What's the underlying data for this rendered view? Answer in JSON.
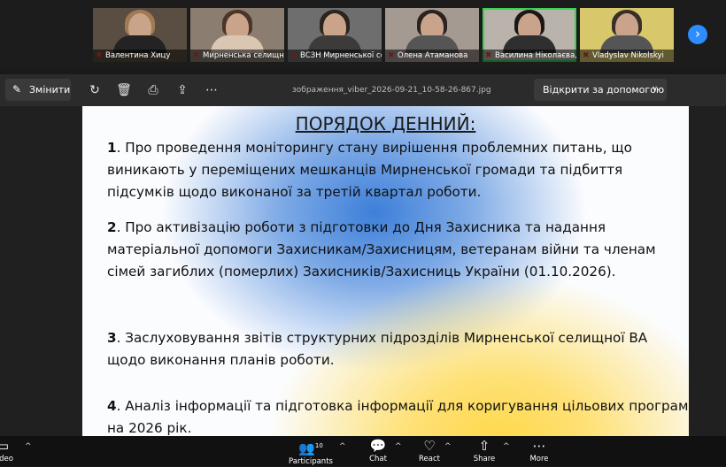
{
  "participants": [
    {
      "name": "Валентина Хицу",
      "hair": "#a07a54",
      "body": "#232323",
      "bg": "#5a4d42"
    },
    {
      "name": "Мирненська селищна ...",
      "hair": "#4a3628",
      "body": "#d9c7b3",
      "bg": "#8b7d70"
    },
    {
      "name": "ВСЗН Мирненської се...",
      "hair": "#2c241e",
      "body": "#3d3a3a",
      "bg": "#6e6e6e"
    },
    {
      "name": "Олена Атаманова",
      "hair": "#2b2320",
      "body": "#555555",
      "bg": "#a49a92"
    },
    {
      "name": "Василина Ніколаєва, Мир...",
      "hair": "#1c1715",
      "body": "#2f2f2f",
      "bg": "#b9b3ac",
      "active": true
    },
    {
      "name": "Vladyslav Nikolskyi",
      "hair": "#3a2f27",
      "body": "#555555",
      "bg": "#d8c86b"
    }
  ],
  "strip": {
    "next_icon": "›"
  },
  "toolbar": {
    "edit_label": "Змінити",
    "file_name": "зображення_viber_2026-09-21_10-58-26-867.jpg",
    "open_with_label": "Відкрити за допомогою",
    "icons": [
      "rotate-icon",
      "trash-icon",
      "print-icon",
      "share-icon",
      "more-icon"
    ]
  },
  "slide": {
    "title": "ПОРЯДОК ДЕННИЙ:",
    "items": [
      {
        "num": "1",
        "text": ". Про проведення моніторингу стану вирішення проблемних питань, що виникають у переміщених мешканців Мирненської громади та підбиття підсумків щодо виконаної за третій квартал роботи."
      },
      {
        "num": "2",
        "text": ". Про активізацію роботи з підготовки до Дня Захисника та надання матеріальної допомоги Захисникам/Захисницям, ветеранам війни та членам сімей загиблих (померлих) Захисників/Захисниць України (01.10.2026)."
      },
      {
        "num": "3",
        "text": ". Заслуховування звітів структурних підрозділів Мирненської селищної ВА щодо виконання планів роботи."
      },
      {
        "num": "4",
        "text": ". Аналіз інформації та підготовка інформації для коригування цільових програм на 2026 рік."
      }
    ]
  },
  "bottombar": {
    "video_label": "Video",
    "participants_label": "Participants",
    "participants_count": "10",
    "chat_label": "Chat",
    "react_label": "React",
    "share_label": "Share",
    "more_label": "More"
  },
  "colors": {
    "accent": "#2d8cff",
    "active_speaker": "#39d353",
    "muted_mic": "#e23b3b"
  }
}
